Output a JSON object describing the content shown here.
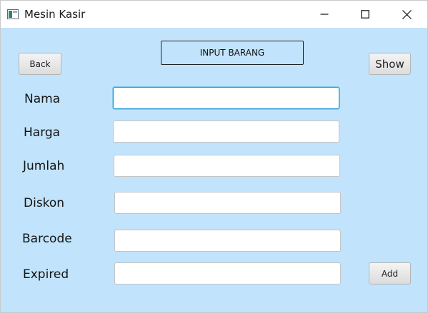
{
  "window": {
    "title": "Mesin Kasir",
    "icon": "java-app-icon"
  },
  "controls": {
    "minimize_icon": "minimize-icon",
    "maximize_icon": "maximize-icon",
    "close_icon": "close-icon"
  },
  "toolbar": {
    "back_label": "Back",
    "show_label": "Show",
    "add_label": "Add"
  },
  "header": {
    "title": "INPUT BARANG"
  },
  "form": {
    "fields": [
      {
        "label": "Nama",
        "value": ""
      },
      {
        "label": "Harga",
        "value": ""
      },
      {
        "label": "Jumlah",
        "value": ""
      },
      {
        "label": "Diskon",
        "value": ""
      },
      {
        "label": "Barcode",
        "value": ""
      },
      {
        "label": "Expired",
        "value": ""
      }
    ],
    "focused_field": "Nama"
  },
  "colors": {
    "background": "#c1e3fb",
    "focus_border": "#1f9ad6"
  }
}
